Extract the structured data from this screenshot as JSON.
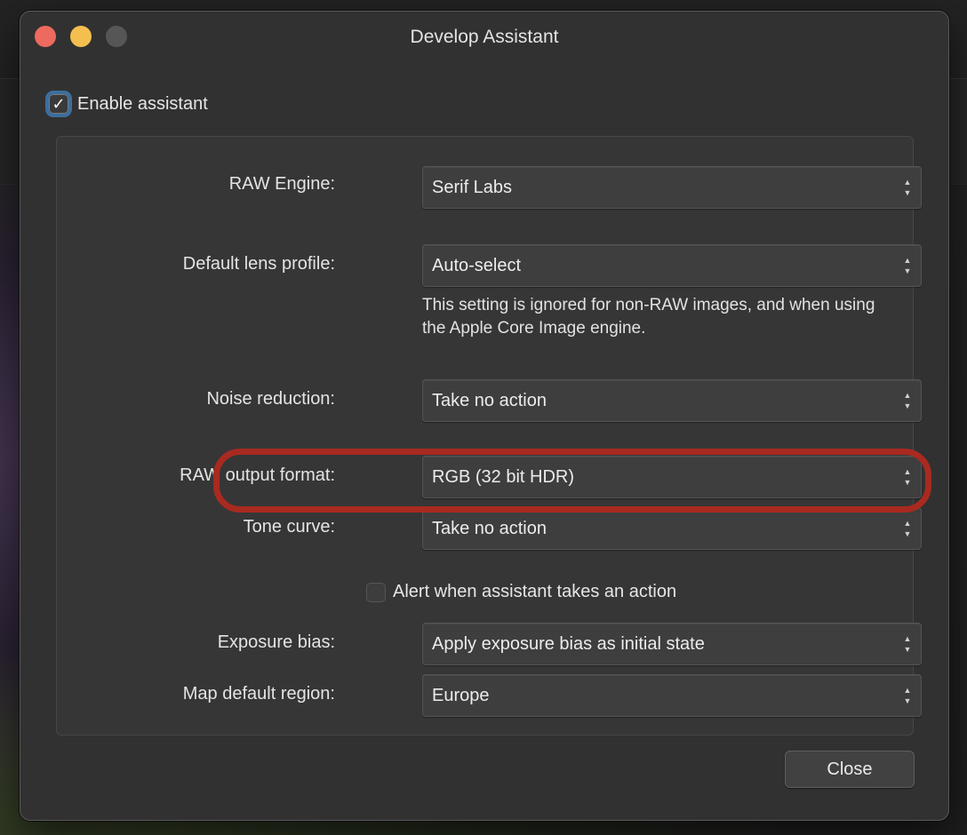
{
  "window": {
    "title": "Develop Assistant"
  },
  "enable": {
    "label": "Enable assistant",
    "checked": true
  },
  "rows": {
    "raw_engine": {
      "label": "RAW Engine:",
      "value": "Serif Labs"
    },
    "lens_profile": {
      "label": "Default lens profile:",
      "value": "Auto-select"
    },
    "lens_note": "This setting is ignored for non-RAW images, and when using the Apple Core Image engine.",
    "noise_reduction": {
      "label": "Noise reduction:",
      "value": "Take no action"
    },
    "raw_output": {
      "label": "RAW output format:",
      "value": "RGB (32 bit HDR)"
    },
    "tone_curve": {
      "label": "Tone curve:",
      "value": "Take no action"
    },
    "exposure_bias": {
      "label": "Exposure bias:",
      "value": "Apply exposure bias as initial state"
    },
    "map_region": {
      "label": "Map default region:",
      "value": "Europe"
    }
  },
  "alert": {
    "label": "Alert when assistant takes an action",
    "checked": false
  },
  "buttons": {
    "close": "Close"
  },
  "icons": {
    "checkmark": "checkmark-icon",
    "popup_arrows": "up-down-chevron-icon"
  },
  "colors": {
    "highlight": "#a82a20",
    "focus_ring": "#3c6e9f",
    "window_bg": "#313131"
  }
}
